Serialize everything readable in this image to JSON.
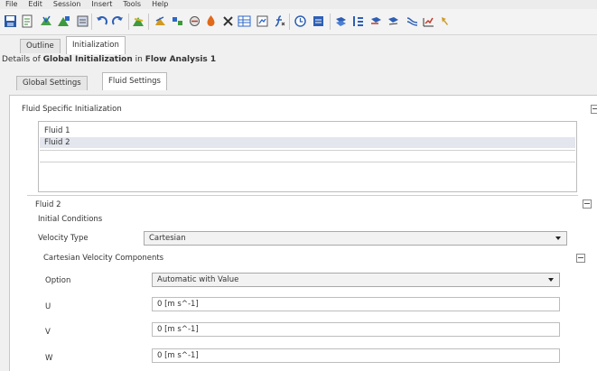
{
  "menu": [
    "File",
    "Edit",
    "Session",
    "Insert",
    "Tools",
    "Help"
  ],
  "toolbar_icons": [
    "save-icon",
    "export-icon",
    "mesh-icon",
    "mesh-import-icon",
    "report-icon",
    "undo-icon",
    "redo-icon",
    "mesh-edit-icon",
    "boundary-icon",
    "domain-icon",
    "interface-icon",
    "source-icon",
    "expression-icon",
    "table-icon",
    "solver-control-icon",
    "function-icon",
    "clock-icon",
    "output-control-icon",
    "plane-icon",
    "pattern-icon",
    "vector-icon",
    "contour-icon",
    "streamline-icon",
    "chart-icon",
    "locator-icon"
  ],
  "outline_tabs": {
    "outline": "Outline",
    "initialization": "Initialization"
  },
  "details": {
    "prefix": "Details of ",
    "object": "Global Initialization",
    "middle": " in ",
    "context": "Flow Analysis 1"
  },
  "sub_tabs": {
    "global": "Global Settings",
    "fluid": "Fluid Settings"
  },
  "fluid_specific": {
    "title": "Fluid Specific Initialization",
    "items": [
      "Fluid 1",
      "Fluid 2"
    ],
    "selected": 1
  },
  "fluid_section": {
    "title": "Fluid 2",
    "initial_conditions": "Initial Conditions",
    "velocity_type_label": "Velocity Type",
    "velocity_type_value": "Cartesian",
    "cartesian_title": "Cartesian Velocity Components",
    "option_label": "Option",
    "option_value": "Automatic with Value",
    "u_label": "U",
    "u_value": "0 [m s^-1]",
    "v_label": "V",
    "v_value": "0 [m s^-1]",
    "w_label": "W",
    "w_value": "0 [m s^-1]"
  }
}
